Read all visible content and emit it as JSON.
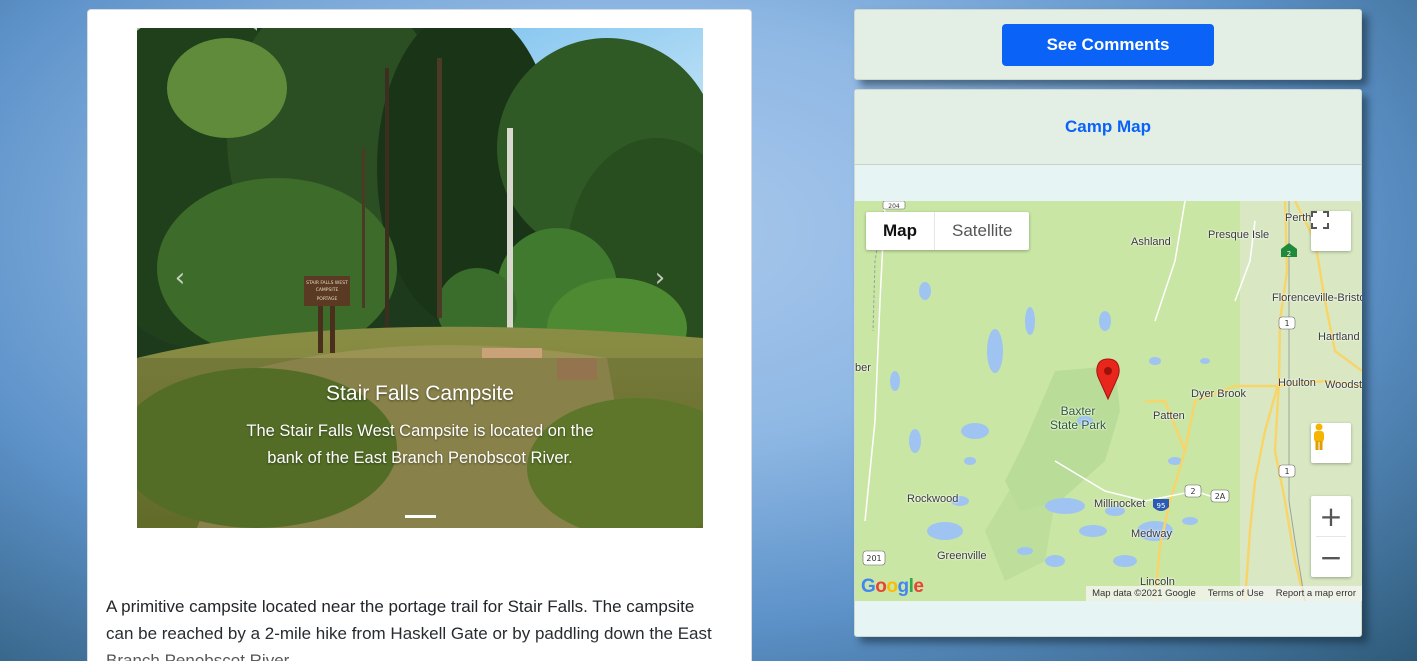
{
  "carousel": {
    "caption_title": "Stair Falls Campsite",
    "caption_text": "The Stair Falls West Campsite is located on the bank of the East Branch Penobscot River.",
    "prev_icon": "chevron-left-icon",
    "next_icon": "chevron-right-icon",
    "sign_text": [
      "STAIR FALLS WEST",
      "CAMPSITE",
      "PORTAGE"
    ]
  },
  "description": "A primitive campsite located near the portage trail for Stair Falls. The campsite can be reached by a 2-mile hike from Haskell Gate or by paddling down the East Branch Penobscot River.",
  "actions": {
    "see_comments": "See Comments"
  },
  "map_panel": {
    "header_link": "Camp Map",
    "map_type": {
      "map": "Map",
      "satellite": "Satellite",
      "selected": "Map"
    },
    "labels": {
      "ashland": "Ashland",
      "presque_isle": "Presque Isle",
      "perth": "Perth-An",
      "florenceville": "Florenceville-Bristo",
      "hartland": "Hartland",
      "houlton": "Houlton",
      "woodstock": "Woodst",
      "dyer_brook": "Dyer Brook",
      "patten": "Patten",
      "baxter": "Baxter",
      "state_park": "State Park",
      "rockwood": "Rockwood",
      "millinocket": "Millinocket",
      "medway": "Medway",
      "greenville": "Greenville",
      "lincoln": "Lincoln",
      "ber": "ber"
    },
    "shields": {
      "r1a": "1",
      "r1b": "1",
      "i95": "95",
      "r2": "2",
      "r2a": "2A",
      "r201": "201",
      "r204": "204",
      "ca2": "2"
    },
    "attribution": {
      "data": "Map data ©2021 Google",
      "terms": "Terms of Use",
      "report": "Report a map error"
    },
    "logo": "Google",
    "zoom_in": "+",
    "zoom_out": "−",
    "icons": [
      "fullscreen-icon",
      "pegman-icon",
      "map-marker-icon"
    ]
  },
  "colors": {
    "accent": "#0a62f7",
    "panel_bg": "#e3efe5",
    "map_land": "#c9e6a4",
    "map_water": "#9fc4f2",
    "marker": "#e8261c"
  }
}
